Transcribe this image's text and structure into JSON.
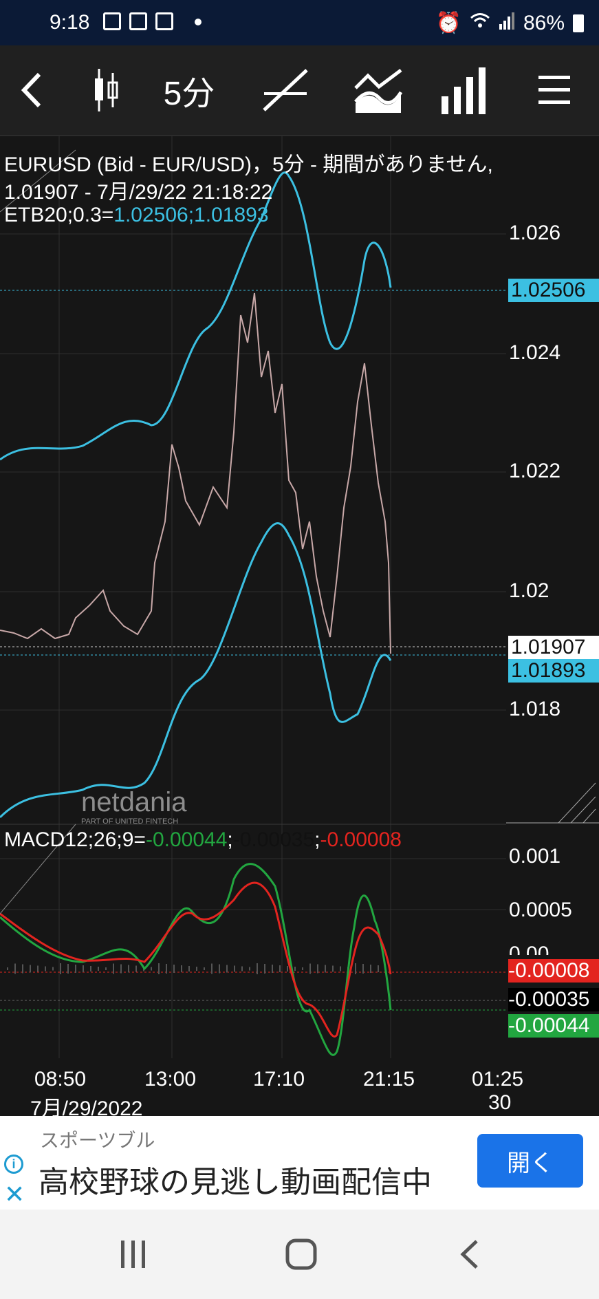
{
  "status_bar": {
    "time": "9:18",
    "battery": "86%"
  },
  "toolbar": {
    "timeframe": "5分"
  },
  "chart_header": {
    "line1": "EURUSD (Bid - EUR/USD)，5分 - 期間がありません,",
    "line2": "1.01907 - 7月/29/22 21:18:22",
    "etb_label": "ETB20;0.3=",
    "etb_values": "1.02506;1.01893"
  },
  "price_axis": [
    "1.026",
    "1.024",
    "1.022",
    "1.02",
    "1.018"
  ],
  "price_badges": {
    "upper_band": "1.02506",
    "last": "1.01907",
    "lower_band": "1.01893"
  },
  "macd": {
    "label": "MACD12;26;9=",
    "v1": "-0.00044",
    "sep1": ";",
    "v2": "-0.00035",
    "sep2": ";",
    "v3": "-0.00008",
    "axis": [
      "0.001",
      "0.0005",
      "0.00"
    ],
    "badge_red": "-0.00008",
    "badge_black": "-0.00035",
    "badge_green": "-0.00044"
  },
  "time_axis": [
    "08:50",
    "13:00",
    "17:10",
    "21:15",
    "01:25"
  ],
  "date_labels": {
    "left": "7月/29/2022",
    "right": "30"
  },
  "watermark": {
    "brand": "netdania",
    "sub": "PART OF UNITED FINTECH"
  },
  "ad": {
    "advertiser": "スポーツブル",
    "headline": "高校野球の見逃し動画配信中",
    "button": "開く"
  },
  "colors": {
    "band": "#3cc0e2",
    "macd_green": "#22a640",
    "macd_red": "#e3241f",
    "background": "#161616"
  },
  "chart_data": {
    "type": "line",
    "price_ylim": [
      1.0162,
      1.0278
    ],
    "x": [
      "08:50",
      "13:00",
      "17:10",
      "21:15"
    ],
    "series": [
      {
        "values": [
          1.0194,
          1.0215,
          1.0255,
          1.0191
        ]
      },
      {
        "values": [
          1.0228,
          1.0234,
          1.027,
          1.0251
        ]
      },
      {
        "values": [
          1.016,
          1.018,
          1.02,
          1.0189
        ]
      }
    ]
  }
}
